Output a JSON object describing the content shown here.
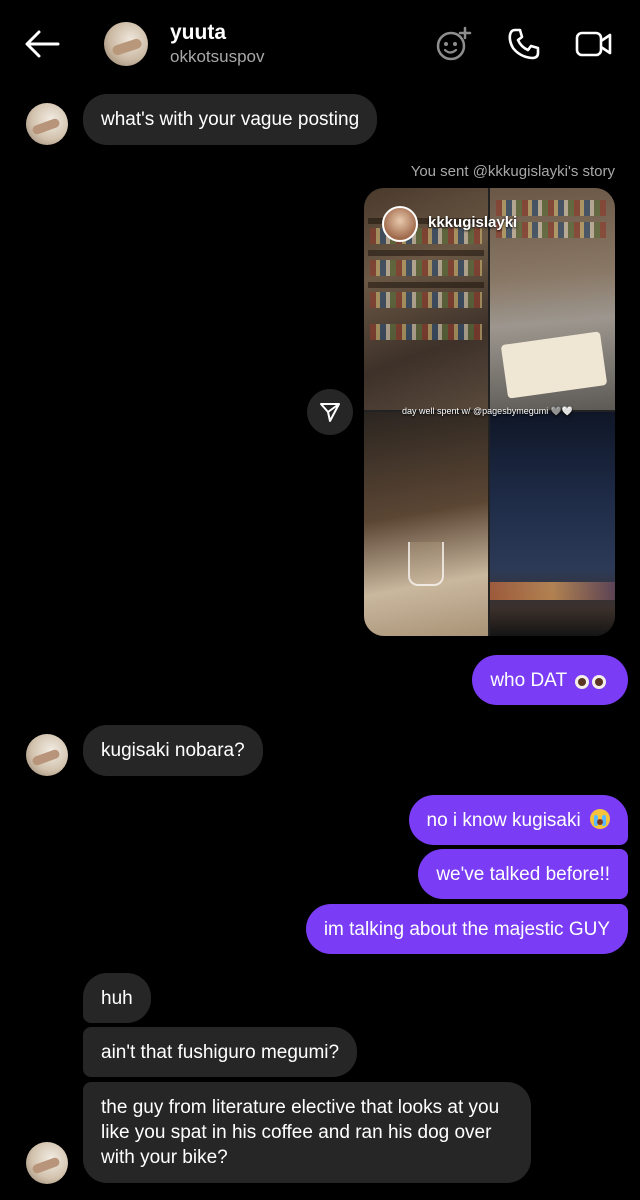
{
  "header": {
    "name": "yuuta",
    "handle": "okkotsuspov",
    "icons": [
      "back-arrow-icon",
      "effects-icon",
      "phone-icon",
      "video-camera-icon"
    ]
  },
  "story": {
    "caption": "You sent @kkkugislayki's story",
    "username": "kkkugislayki",
    "tag_text": "day well spent w/ @pagesbymegumi 🩶🤍"
  },
  "messages": {
    "m1": "what's with your vague posting",
    "m2": "who DAT",
    "m3": "kugisaki nobara?",
    "m4": "no i know kugisaki",
    "m5": "we've talked before!!",
    "m6": "im talking about the majestic GUY",
    "m7": "huh",
    "m8": "ain't that fushiguro megumi?",
    "m9": "the guy from literature elective that looks at you like you spat in his coffee and ran his dog over with your bike?"
  },
  "colors": {
    "background": "#000000",
    "received_bubble": "#262626",
    "sent_bubble": "#7a3cf5",
    "secondary_text": "#a8a8a8"
  }
}
